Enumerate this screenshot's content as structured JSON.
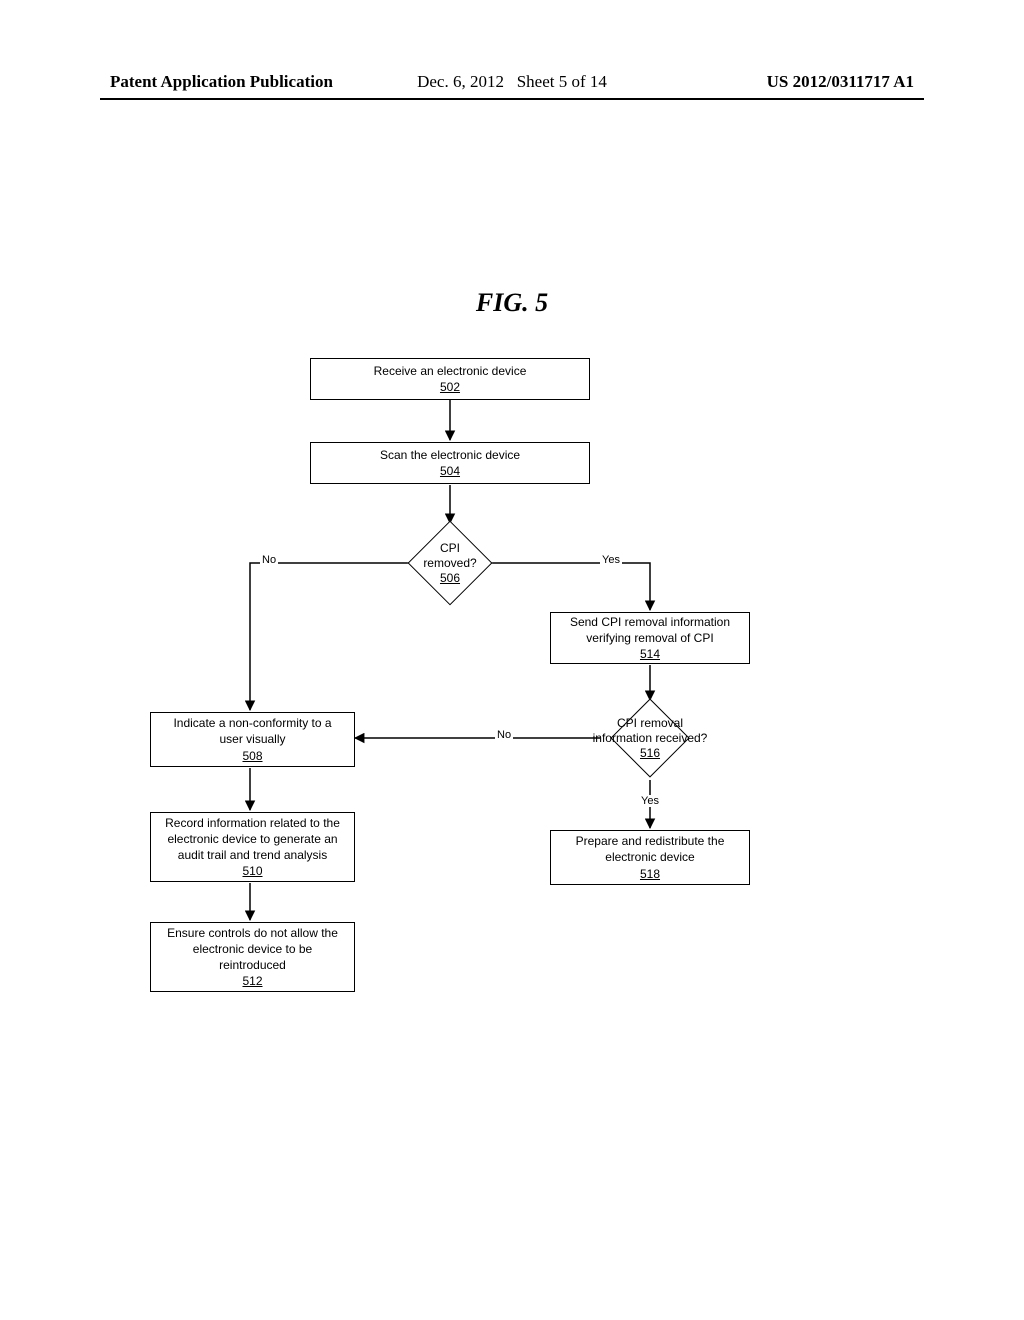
{
  "header": {
    "left": "Patent Application Publication",
    "mid_date": "Dec. 6, 2012",
    "mid_sheet": "Sheet 5 of 14",
    "right": "US 2012/0311717 A1"
  },
  "figure_title": "FIG. 5",
  "boxes": {
    "b502": {
      "text": "Receive an electronic device",
      "num": "502"
    },
    "b504": {
      "text": "Scan the electronic device",
      "num": "504"
    },
    "b508_l1": "Indicate a non-conformity to a",
    "b508_l2": "user visually",
    "b508_num": "508",
    "b510_l1": "Record information related to the",
    "b510_l2": "electronic device to generate an",
    "b510_l3": "audit trail and trend analysis",
    "b510_num": "510",
    "b512_l1": "Ensure controls do not allow the",
    "b512_l2": "electronic device to be",
    "b512_l3": "reintroduced",
    "b512_num": "512",
    "b514_l1": "Send CPI removal information",
    "b514_l2": "verifying removal of CPI",
    "b514_num": "514",
    "b518_l1": "Prepare and redistribute the",
    "b518_l2": "electronic device",
    "b518_num": "518"
  },
  "diamonds": {
    "d506_l1": "CPI",
    "d506_l2": "removed?",
    "d506_num": "506",
    "d516_l1": "CPI removal",
    "d516_l2": "information received?",
    "d516_num": "516"
  },
  "labels": {
    "no": "No",
    "yes": "Yes"
  }
}
